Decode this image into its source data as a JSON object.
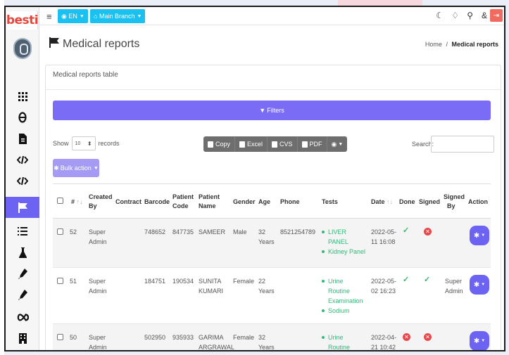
{
  "app": {
    "logo_text": "besti",
    "language": "EN",
    "branch": "Main Branch"
  },
  "sidebar": {
    "icons": [
      "grid-icon",
      "theta-icon",
      "document-icon",
      "code-icon",
      "code-icon",
      "flag-icon",
      "list-icon",
      "flask-icon",
      "pen-icon",
      "pen-icon",
      "infinity-icon",
      "building-icon"
    ],
    "active_index": 5
  },
  "topbar": {
    "icons": [
      "moon-icon",
      "bell-icon",
      "chat-icon",
      "users-icon",
      "logout-icon"
    ]
  },
  "page": {
    "title": "Medical reports",
    "breadcrumb_home": "Home",
    "breadcrumb_sep": "/",
    "breadcrumb_current": "Medical reports"
  },
  "card": {
    "title": "Medical reports table",
    "filters_label": "Filters",
    "show_label": "Show",
    "records_label": "records",
    "show_value": "10",
    "export_buttons": [
      "Copy",
      "Excel",
      "CVS",
      "PDF"
    ],
    "search_label": "Search:",
    "bulk_action_label": "Bulk action"
  },
  "table": {
    "headers": {
      "num": "#",
      "created_by_1": "Created",
      "created_by_2": "By",
      "contract": "Contract",
      "barcode": "Barcode",
      "patient_code_1": "Patient",
      "patient_code_2": "Code",
      "patient_name_1": "Patient",
      "patient_name_2": "Name",
      "gender": "Gender",
      "age": "Age",
      "phone": "Phone",
      "tests": "Tests",
      "date": "Date",
      "done": "Done",
      "signed": "Signed",
      "signed_by_1": "Signed",
      "signed_by_2": "By",
      "action": "Action"
    },
    "rows": [
      {
        "num": "52",
        "created_by_1": "Super",
        "created_by_2": "Admin",
        "barcode": "748652",
        "patient_code": "847735",
        "name_1": "SAMEER",
        "name_2": "",
        "gender": "Male",
        "age_1": "32",
        "age_2": "Years",
        "phone": "8521254789",
        "tests": [
          "LIVER PANEL",
          "Kidney Panel"
        ],
        "date_1": "2022-05-",
        "date_2": "11 16:08",
        "done": true,
        "signed": false,
        "signed_by_1": "",
        "signed_by_2": ""
      },
      {
        "num": "51",
        "created_by_1": "Super",
        "created_by_2": "Admin",
        "barcode": "184751",
        "patient_code": "190534",
        "name_1": "SUNITA",
        "name_2": "KUMARI",
        "gender": "Female",
        "age_1": "22",
        "age_2": "Years",
        "phone": "",
        "tests": [
          "Urine Routine Examination",
          "Sodium"
        ],
        "date_1": "2022-05-",
        "date_2": "02 16:23",
        "done": true,
        "signed": true,
        "signed_by_1": "Super",
        "signed_by_2": "Admin"
      },
      {
        "num": "50",
        "created_by_1": "Super",
        "created_by_2": "Admin",
        "barcode": "502950",
        "patient_code": "935933",
        "name_1": "GARIMA",
        "name_2": "ARGRAWAL",
        "gender": "Female",
        "age_1": "32",
        "age_2": "Years",
        "phone": "",
        "tests": [
          "Urine Routine Examination"
        ],
        "date_1": "2022-04-",
        "date_2": "21 10:42",
        "done": false,
        "signed": false,
        "signed_by_1": "",
        "signed_by_2": ""
      }
    ]
  }
}
